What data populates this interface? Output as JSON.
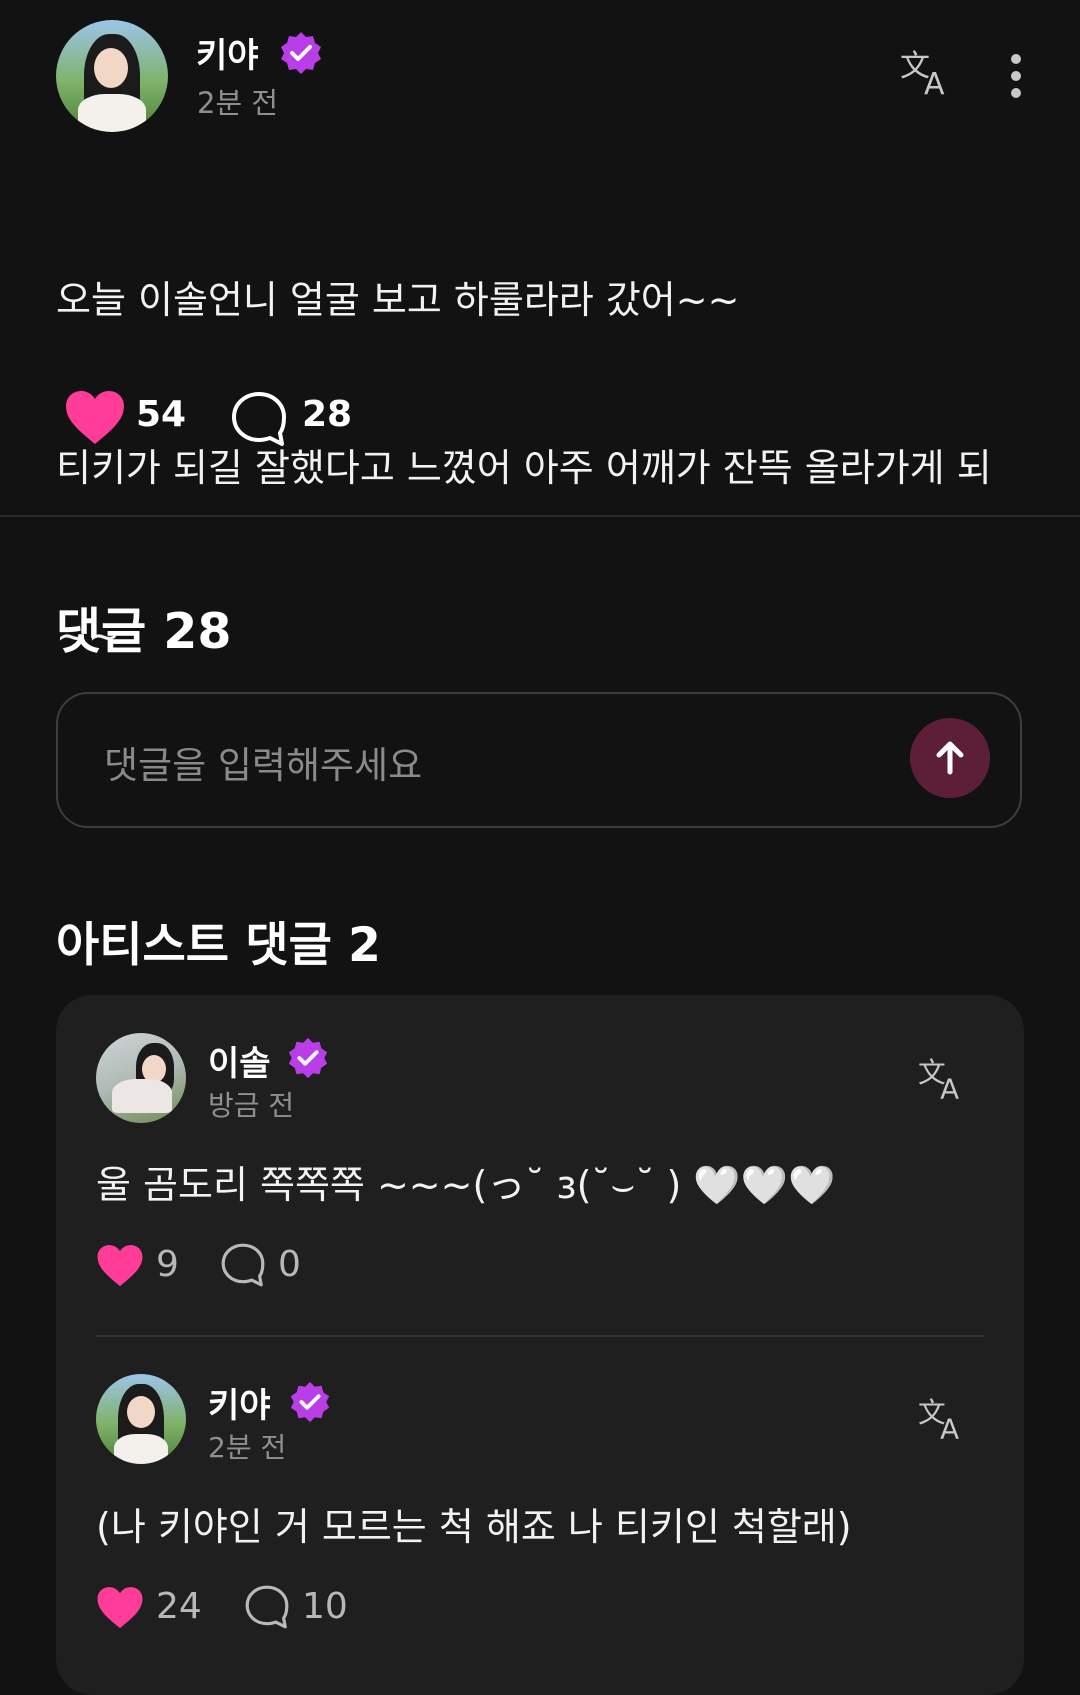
{
  "post": {
    "author": "키야",
    "time": "2분 전",
    "text_line1": "오늘 이솔언니 얼굴 보고 하룰라라 갔어~~",
    "text_line2": "티키가 되길 잘했다고 느꼈어 아주 어깨가 잔뜩 올라가게 되",
    "text_line3": "~~",
    "likes": "54",
    "comments": "28"
  },
  "comments_section": {
    "title": "댓글 28",
    "input_placeholder": "댓글을 입력해주세요"
  },
  "artist_comments": {
    "title": "아티스트 댓글 2",
    "items": [
      {
        "author": "이솔",
        "time": "방금 전",
        "text": "울 곰도리 쪽쪽쪽 ~~~(っ˘ з(˘⌣˘ ) 🤍🤍🤍",
        "likes": "9",
        "replies": "0"
      },
      {
        "author": "키야",
        "time": "2분 전",
        "text": "(나 키야인 거 모르는 척 해죠 나 티키인 척할래)",
        "likes": "24",
        "replies": "10"
      }
    ]
  },
  "colors": {
    "background": "#121212",
    "heart": "#ff3d98",
    "badge": "#b93ee8",
    "send_button": "#5c1f37",
    "card": "#1f1f1f"
  },
  "icons": [
    "verified-badge-icon",
    "translate-icon",
    "more-vertical-icon",
    "heart-icon",
    "comment-bubble-icon",
    "arrow-up-icon"
  ]
}
